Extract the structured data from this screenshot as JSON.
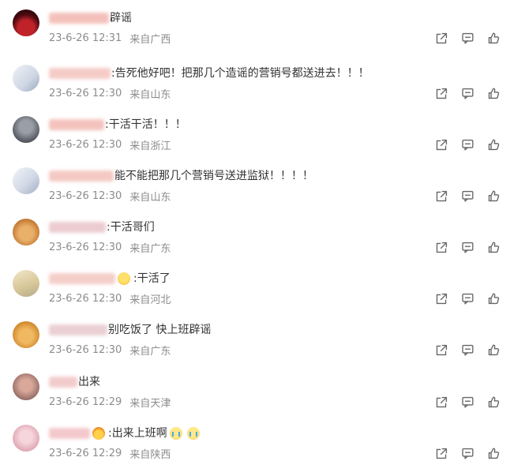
{
  "comments": [
    {
      "user": "",
      "emoji": "",
      "text": "辟谣",
      "time": "23-6-26 12:31",
      "location": "来自广西"
    },
    {
      "user": "",
      "emoji": "",
      "text": ":告死他好吧！把那几个造谣的营销号都送进去！！！",
      "time": "23-6-26 12:30",
      "location": "来自山东"
    },
    {
      "user": "",
      "emoji": "",
      "text": ":干活干活！！！",
      "time": "23-6-26 12:30",
      "location": "来自浙江"
    },
    {
      "user": "",
      "emoji": "",
      "text": "能不能把那几个营销号送进监狱！！！！",
      "time": "23-6-26 12:30",
      "location": "来自山东"
    },
    {
      "user": "",
      "emoji": "",
      "text": ":干活哥们",
      "time": "23-6-26 12:30",
      "location": "来自广东"
    },
    {
      "user": "",
      "emoji": "",
      "text": ":干活了",
      "time": "23-6-26 12:30",
      "location": "来自河北"
    },
    {
      "user": "",
      "emoji": "",
      "text": "别吃饭了 快上班辟谣",
      "time": "23-6-26 12:30",
      "location": "来自广东"
    },
    {
      "user": "",
      "emoji": "",
      "text": "出来",
      "time": "23-6-26 12:29",
      "location": "来自天津"
    },
    {
      "user": "",
      "emoji": "",
      "text": ":出来上班啊",
      "time": "23-6-26 12:29",
      "location": "来自陕西"
    }
  ],
  "action_icons": [
    "share-icon",
    "comment-icon",
    "like-icon"
  ],
  "colors": {
    "meta_text": "#8c8c8c",
    "body_text": "#333333",
    "icon": "#666666"
  }
}
